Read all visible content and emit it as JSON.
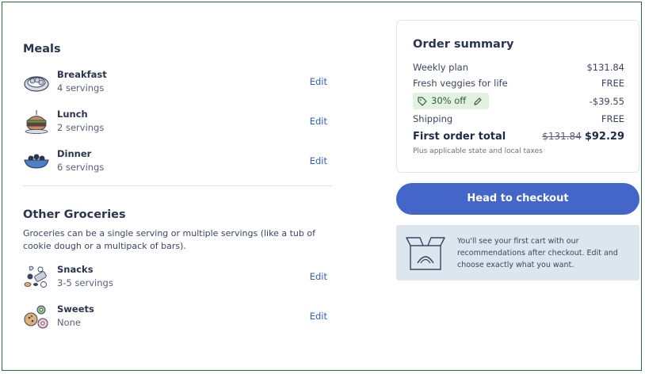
{
  "meals": {
    "title": "Meals",
    "items": [
      {
        "name": "Breakfast",
        "servings": "4 servings",
        "edit": "Edit",
        "icon": "breakfast-plate-icon"
      },
      {
        "name": "Lunch",
        "servings": "2 servings",
        "edit": "Edit",
        "icon": "lunch-burger-icon"
      },
      {
        "name": "Dinner",
        "servings": "6 servings",
        "edit": "Edit",
        "icon": "dinner-bowl-icon"
      }
    ]
  },
  "groceries": {
    "title": "Other Groceries",
    "description": "Groceries can be a single serving or multiple servings (like a tub of cookie dough or a multipack of bars).",
    "items": [
      {
        "name": "Snacks",
        "servings": "3-5 servings",
        "edit": "Edit",
        "icon": "snacks-icon"
      },
      {
        "name": "Sweets",
        "servings": "None",
        "edit": "Edit",
        "icon": "sweets-icon"
      }
    ]
  },
  "summary": {
    "title": "Order summary",
    "weekly_plan_label": "Weekly plan",
    "weekly_plan_value": "$131.84",
    "veggies_label": "Fresh veggies for life",
    "veggies_value": "FREE",
    "promo_label": "30% off",
    "promo_value": "-$39.55",
    "shipping_label": "Shipping",
    "shipping_value": "FREE",
    "total_label": "First order total",
    "total_original": "$131.84",
    "total_value": "$92.29",
    "tax_note": "Plus applicable state and local taxes"
  },
  "checkout": {
    "button_label": "Head to checkout",
    "info_text": "You'll see your first cart with our recommendations after checkout. Edit and choose exactly what you want."
  },
  "colors": {
    "accent": "#4466c8",
    "link": "#2f5fb3",
    "promo_bg": "#e3f1e3",
    "info_bg": "#dce6ee"
  }
}
